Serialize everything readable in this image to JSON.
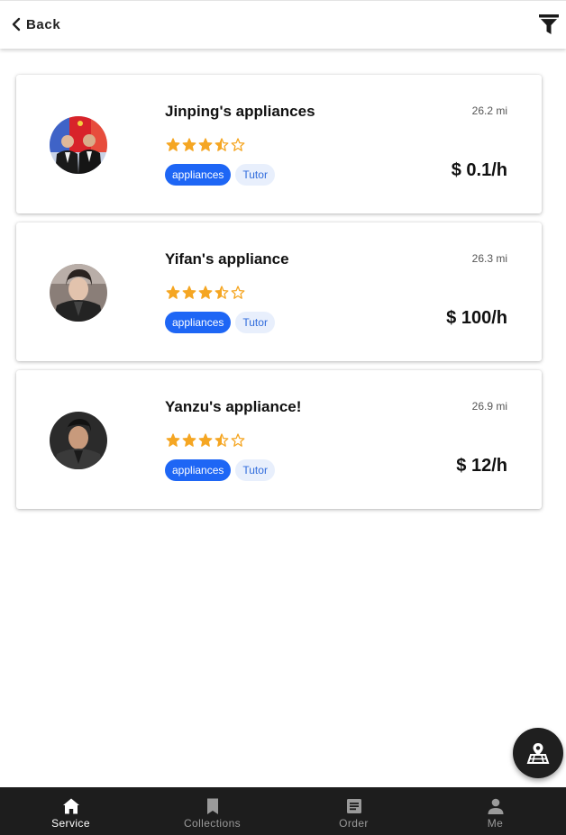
{
  "header": {
    "back_label": "Back",
    "back_icon": "chevron-left-icon",
    "filter_icon": "filter-icon"
  },
  "services": [
    {
      "name": "Jinping's appliances",
      "distance": "26.2 mi",
      "rating": 3.5,
      "max_rating": 5,
      "tags": [
        "appliances",
        "Tutor"
      ],
      "price": "$ 0.1/h"
    },
    {
      "name": "Yifan's appliance",
      "distance": "26.3 mi",
      "rating": 3.5,
      "max_rating": 5,
      "tags": [
        "appliances",
        "Tutor"
      ],
      "price": "$ 100/h"
    },
    {
      "name": "Yanzu's appliance!",
      "distance": "26.9 mi",
      "rating": 3.5,
      "max_rating": 5,
      "tags": [
        "appliances",
        "Tutor"
      ],
      "price": "$ 12/h"
    }
  ],
  "fab": {
    "icon": "map-marker-icon"
  },
  "bottom_nav": [
    {
      "label": "Service",
      "icon": "home-icon",
      "active": true
    },
    {
      "label": "Collections",
      "icon": "bookmark-icon",
      "active": false
    },
    {
      "label": "Order",
      "icon": "receipt-icon",
      "active": false
    },
    {
      "label": "Me",
      "icon": "person-icon",
      "active": false
    }
  ],
  "colors": {
    "accent": "#1e66f5",
    "star": "#f5a623",
    "nav_background": "#1d1d1d",
    "fab_background": "#1f1f1f"
  }
}
